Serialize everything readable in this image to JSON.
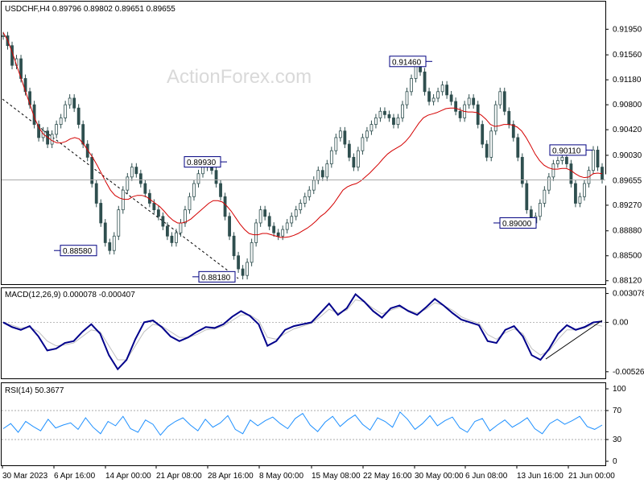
{
  "chart_data": [
    {
      "type": "candlestick",
      "title": "USDCHF,H4  0.89796 0.89802 0.89651 0.89655",
      "watermark": "ActionForex.com",
      "ylim": [
        0.8808,
        0.9215
      ],
      "y_ticks": [
        "0.91950",
        "0.91560",
        "0.91180",
        "0.90800",
        "0.90420",
        "0.90030",
        "0.89650",
        "0.89270",
        "0.88880",
        "0.88500",
        "0.88120"
      ],
      "current_price": "0.89655",
      "price_series": [
        0.9185,
        0.917,
        0.914,
        0.915,
        0.912,
        0.91,
        0.908,
        0.905,
        0.903,
        0.904,
        0.902,
        0.9035,
        0.905,
        0.906,
        0.908,
        0.909,
        0.9075,
        0.905,
        0.902,
        0.9,
        0.896,
        0.893,
        0.89,
        0.887,
        0.8858,
        0.888,
        0.892,
        0.895,
        0.897,
        0.8985,
        0.8975,
        0.896,
        0.8945,
        0.893,
        0.892,
        0.891,
        0.8895,
        0.888,
        0.887,
        0.8885,
        0.89,
        0.892,
        0.894,
        0.896,
        0.8975,
        0.8985,
        0.8993,
        0.898,
        0.896,
        0.894,
        0.891,
        0.888,
        0.885,
        0.883,
        0.882,
        0.884,
        0.887,
        0.89,
        0.892,
        0.891,
        0.8895,
        0.8885,
        0.888,
        0.889,
        0.89,
        0.891,
        0.892,
        0.893,
        0.894,
        0.895,
        0.8965,
        0.898,
        0.897,
        0.899,
        0.901,
        0.903,
        0.904,
        0.902,
        0.9,
        0.8985,
        0.901,
        0.903,
        0.904,
        0.905,
        0.906,
        0.907,
        0.9065,
        0.906,
        0.905,
        0.906,
        0.908,
        0.91,
        0.912,
        0.914,
        0.913,
        0.91,
        0.9085,
        0.909,
        0.91,
        0.911,
        0.9095,
        0.9085,
        0.907,
        0.906,
        0.908,
        0.909,
        0.908,
        0.905,
        0.902,
        0.9,
        0.904,
        0.908,
        0.91,
        0.907,
        0.905,
        0.903,
        0.9,
        0.896,
        0.892,
        0.89,
        0.891,
        0.893,
        0.895,
        0.897,
        0.899,
        0.8995,
        0.9,
        0.899,
        0.896,
        0.893,
        0.894,
        0.896,
        0.898,
        0.9011,
        0.8985,
        0.8966
      ],
      "ma_series": [
        0.919,
        0.9178,
        0.916,
        0.914,
        0.912,
        0.91,
        0.908,
        0.906,
        0.9045,
        0.9035,
        0.903,
        0.9025,
        0.9022,
        0.9022,
        0.9024,
        0.9028,
        0.903,
        0.9028,
        0.902,
        0.901,
        0.9,
        0.8988,
        0.8975,
        0.8962,
        0.895,
        0.8942,
        0.8938,
        0.8936,
        0.8936,
        0.894,
        0.8942,
        0.8942,
        0.894,
        0.8935,
        0.893,
        0.8925,
        0.8918,
        0.891,
        0.8904,
        0.89,
        0.89,
        0.8902,
        0.8906,
        0.8912,
        0.8918,
        0.8924,
        0.893,
        0.8934,
        0.8934,
        0.8932,
        0.8926,
        0.8918,
        0.8908,
        0.8898,
        0.889,
        0.8884,
        0.8882,
        0.8882,
        0.8884,
        0.8884,
        0.8882,
        0.888,
        0.8878,
        0.8878,
        0.8879,
        0.8881,
        0.8884,
        0.8888,
        0.8892,
        0.8897,
        0.8903,
        0.891,
        0.8915,
        0.8922,
        0.893,
        0.894,
        0.895,
        0.8955,
        0.8958,
        0.896,
        0.8964,
        0.897,
        0.8976,
        0.8983,
        0.899,
        0.8998,
        0.9005,
        0.901,
        0.9014,
        0.9018,
        0.9024,
        0.9032,
        0.9042,
        0.9052,
        0.906,
        0.9064,
        0.9066,
        0.9068,
        0.9071,
        0.9074,
        0.9075,
        0.9075,
        0.9073,
        0.907,
        0.9069,
        0.9069,
        0.9068,
        0.9064,
        0.9058,
        0.905,
        0.9047,
        0.9048,
        0.905,
        0.905,
        0.9049,
        0.9046,
        0.904,
        0.903,
        0.9018,
        0.9005,
        0.8995,
        0.8988,
        0.8984,
        0.8982,
        0.8982,
        0.8983,
        0.8983,
        0.898,
        0.8975,
        0.8971,
        0.8969,
        0.897,
        0.8975,
        0.8976,
        0.8975
      ],
      "annotations": [
        {
          "label": "0.91460",
          "value": 0.9146,
          "anchor": "left"
        },
        {
          "label": "0.89930",
          "value": 0.8993,
          "anchor": "left"
        },
        {
          "label": "0.88580",
          "value": 0.8858,
          "anchor": "right"
        },
        {
          "label": "0.88180",
          "value": 0.8818,
          "anchor": "right"
        },
        {
          "label": "0.90110",
          "value": 0.9011,
          "anchor": "left"
        },
        {
          "label": "0.89000",
          "value": 0.89,
          "anchor": "right"
        }
      ],
      "grid": false
    },
    {
      "type": "line",
      "title": "MACD(12,26,9) 0.000078 -0.000407",
      "ylim": [
        -0.0058,
        0.0033
      ],
      "y_ticks": [
        "0.003078",
        "0.00",
        "-0.005268"
      ],
      "zero_label": "0.00",
      "series": [
        {
          "role": "main",
          "color": "#00008b",
          "values": [
            0.0,
            -0.0005,
            -0.0008,
            -0.0004,
            -0.0015,
            -0.003,
            -0.0028,
            -0.0022,
            -0.002,
            -0.001,
            -0.0002,
            -0.0012,
            -0.0035,
            -0.005,
            -0.004,
            -0.0018,
            0.0,
            0.0002,
            -0.0005,
            -0.0015,
            -0.002,
            -0.0016,
            -0.001,
            -0.0005,
            -0.0006,
            -0.0002,
            0.0006,
            0.0012,
            0.0007,
            -0.0002,
            -0.0025,
            -0.002,
            -0.0008,
            -0.0004,
            -0.0002,
            0.0,
            0.001,
            0.002,
            0.0008,
            0.0015,
            0.003,
            0.0022,
            0.0012,
            0.0005,
            0.0015,
            0.0018,
            0.0012,
            0.0008,
            0.0016,
            0.0025,
            0.0018,
            0.001,
            0.0003,
            0.0,
            -0.0003,
            -0.002,
            -0.0022,
            -0.0008,
            -0.0004,
            -0.0015,
            -0.0035,
            -0.004,
            -0.0028,
            -0.0012,
            -0.0003,
            -0.0008,
            -0.0005,
            0.0,
            0.0001
          ]
        },
        {
          "role": "signal",
          "color": "#c0c0c0",
          "values": [
            0.0,
            -0.0003,
            -0.0006,
            -0.0005,
            -0.001,
            -0.002,
            -0.0025,
            -0.0024,
            -0.0022,
            -0.0015,
            -0.0008,
            -0.001,
            -0.0025,
            -0.004,
            -0.004,
            -0.0025,
            -0.001,
            -0.0002,
            -0.0004,
            -0.001,
            -0.0016,
            -0.0016,
            -0.0013,
            -0.0008,
            -0.0007,
            -0.0004,
            0.0002,
            0.0008,
            0.0008,
            0.0002,
            -0.0016,
            -0.0018,
            -0.0012,
            -0.0007,
            -0.0004,
            -0.0001,
            0.0006,
            0.0014,
            0.001,
            0.0013,
            0.0024,
            0.0022,
            0.0015,
            0.0009,
            0.0013,
            0.0016,
            0.0013,
            0.001,
            0.0014,
            0.0021,
            0.0018,
            0.0013,
            0.0006,
            0.0002,
            -0.0001,
            -0.0013,
            -0.0018,
            -0.0011,
            -0.0007,
            -0.0012,
            -0.0028,
            -0.0035,
            -0.003,
            -0.0018,
            -0.0008,
            -0.0008,
            -0.0006,
            -0.0002,
            -0.0004
          ]
        }
      ]
    },
    {
      "type": "line",
      "title": "RSI(14) 50.3677",
      "ylim": [
        0,
        100
      ],
      "y_ticks": [
        "100",
        "70",
        "30",
        "0"
      ],
      "levels": [
        70,
        30
      ],
      "series": [
        {
          "role": "rsi",
          "color": "#1e90ff",
          "values": [
            45,
            52,
            40,
            55,
            48,
            42,
            58,
            46,
            50,
            53,
            44,
            60,
            47,
            38,
            55,
            49,
            62,
            45,
            40,
            57,
            51,
            36,
            48,
            55,
            60,
            50,
            42,
            58,
            47,
            53,
            63,
            44,
            38,
            57,
            49,
            56,
            61,
            52,
            45,
            59,
            66,
            50,
            41,
            54,
            62,
            48,
            57,
            64,
            51,
            43,
            60,
            55,
            47,
            68,
            58,
            44,
            52,
            63,
            49,
            56,
            61,
            46,
            40,
            55,
            59,
            42,
            50,
            57,
            47,
            53,
            60,
            45,
            38,
            52,
            58,
            51,
            56,
            62,
            48,
            44,
            50
          ]
        }
      ]
    }
  ],
  "x_axis_labels": [
    "30 Mar 2023",
    "6 Apr 16:00",
    "14 Apr 00:00",
    "21 Apr 08:00",
    "28 Apr 16:00",
    "8 May 00:00",
    "15 May 08:00",
    "22 May 16:00",
    "30 May 00:00",
    "6 Jun 08:00",
    "13 Jun 16:00",
    "21 Jun 00:00"
  ],
  "colors": {
    "candle": "#2f4f4f",
    "ma": "#d40000",
    "macd": "#00008b",
    "signal": "#c0c0c0",
    "rsi": "#1e90ff",
    "annotation_box": "#000080",
    "current_line": "#aaaaaa",
    "watermark": "#d9d9d9"
  }
}
